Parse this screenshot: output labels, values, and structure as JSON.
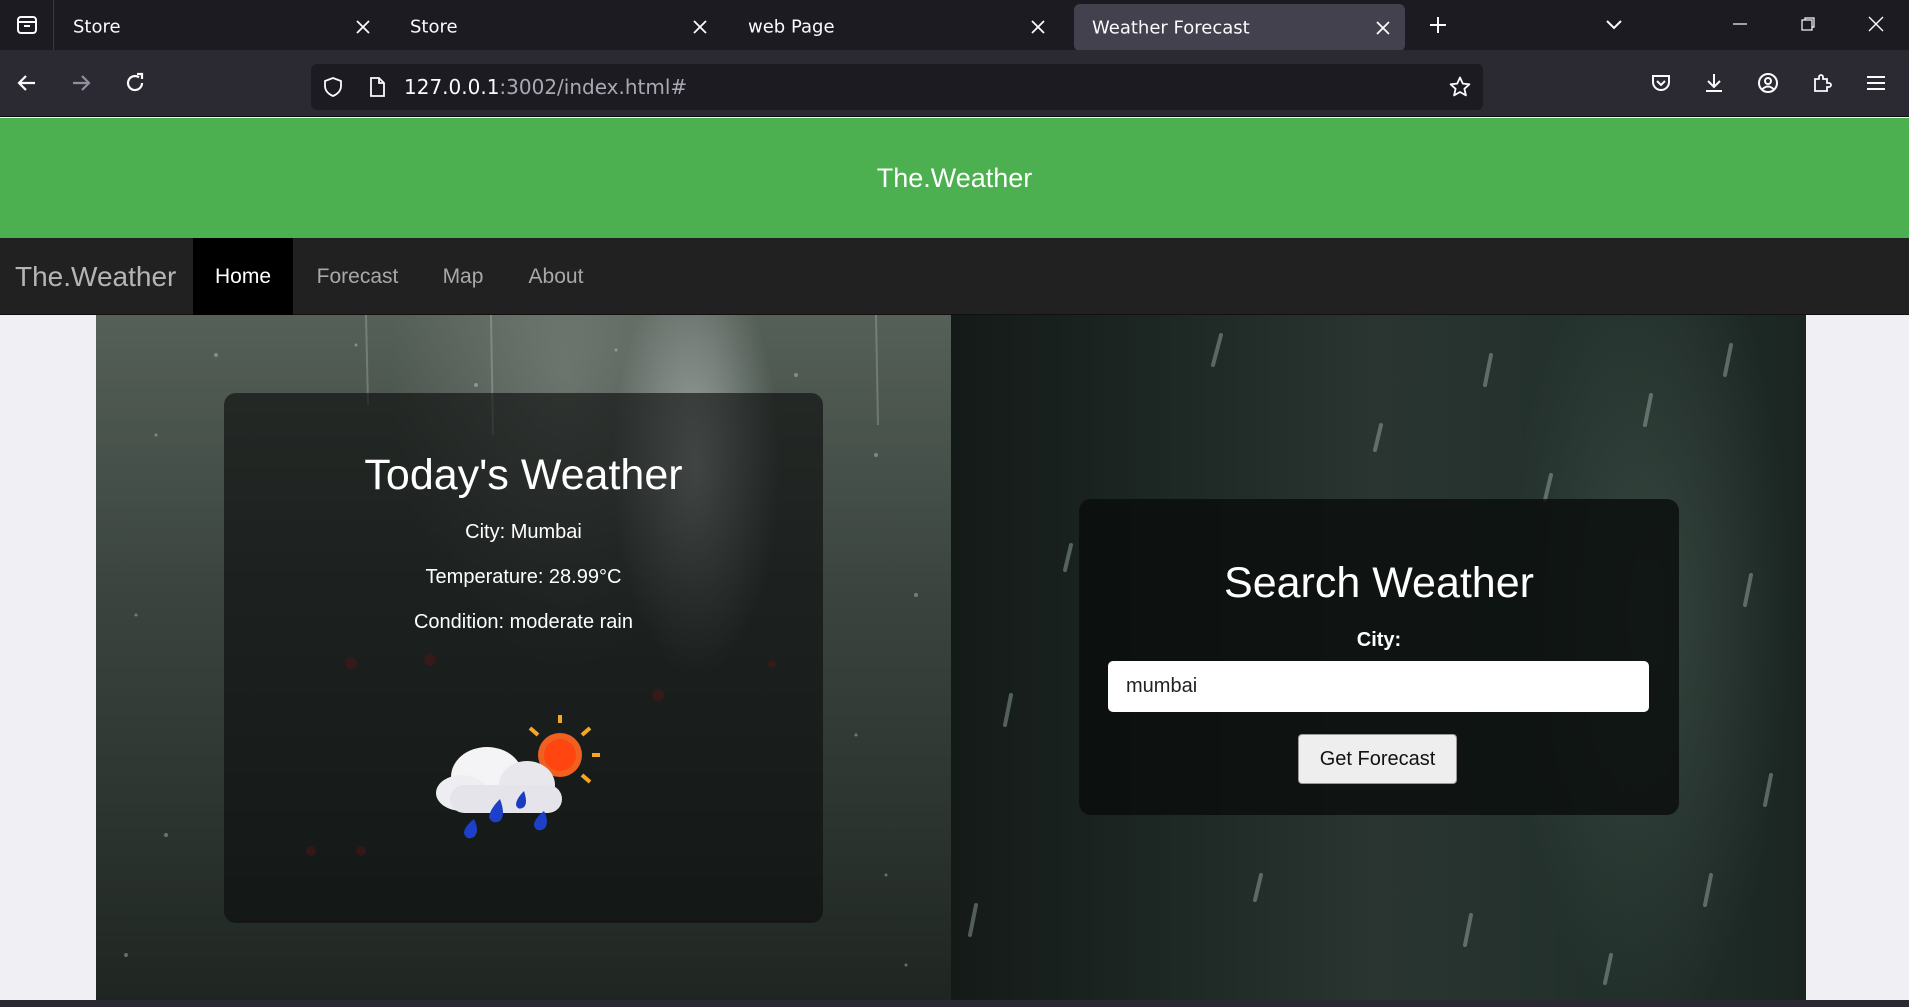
{
  "browser": {
    "tabs": [
      {
        "title": "Store",
        "active": false
      },
      {
        "title": "Store",
        "active": false
      },
      {
        "title": "web Page",
        "active": false
      },
      {
        "title": "Weather Forecast",
        "active": true
      }
    ],
    "url_host": "127.0.0.1",
    "url_rest": ":3002/index.html#"
  },
  "header": {
    "title": "The.Weather"
  },
  "nav": {
    "brand": "The.Weather",
    "links": [
      {
        "label": "Home",
        "active": true
      },
      {
        "label": "Forecast",
        "active": false
      },
      {
        "label": "Map",
        "active": false
      },
      {
        "label": "About",
        "active": false
      }
    ]
  },
  "today": {
    "heading": "Today's Weather",
    "city": "City: Mumbai",
    "temperature": "Temperature: 28.99°C",
    "condition": "Condition: moderate rain",
    "icon": "rain-sun-cloud-icon"
  },
  "search": {
    "heading": "Search Weather",
    "city_label": "City:",
    "city_value": "mumbai",
    "button_label": "Get Forecast"
  },
  "colors": {
    "header_green": "#4caf50",
    "nav_bg": "#212121"
  }
}
